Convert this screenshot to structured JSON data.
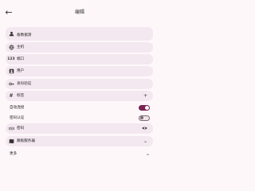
{
  "header": {
    "back_icon": "arrow-back-icon",
    "title": "编辑"
  },
  "fields": {
    "name": {
      "icon": "person-icon",
      "value": "备数据测"
    },
    "host": {
      "icon": "globe-icon",
      "value": "主机"
    },
    "port": {
      "icon": "numeric-icon",
      "value": "端口"
    },
    "user": {
      "icon": "account-box-icon",
      "value": "用户"
    },
    "key": {
      "icon": "key-icon",
      "value": "身份验证"
    },
    "tags": {
      "icon": "hashtag-icon",
      "value": "标签",
      "trailing": "+"
    },
    "password": {
      "icon": "password-icon",
      "value": "密码",
      "trailing_icon": "eye-icon"
    },
    "jump": {
      "icon": "map-icon",
      "value": "跳板服务器",
      "trailing_icon": "chevron-down-icon"
    }
  },
  "toggles": {
    "auto_connect": {
      "label": "自动连接",
      "on": true
    },
    "password_auth": {
      "label": "密码认证",
      "on": false
    }
  },
  "more": {
    "label": "更多"
  },
  "colors": {
    "background": "#fdf7fa",
    "field_bg": "#f3e8ef",
    "accent": "#7b2352"
  }
}
